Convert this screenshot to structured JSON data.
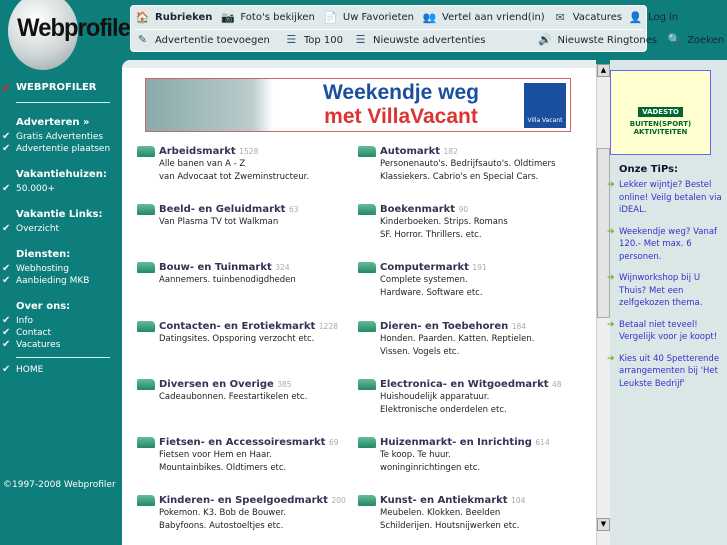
{
  "logo": "Webprofiler",
  "nav": {
    "row1": [
      {
        "icon": "house-icon",
        "label": "Rubrieken"
      },
      {
        "icon": "camera-icon",
        "label": "Foto's bekijken"
      },
      {
        "icon": "favorites-icon",
        "label": "Uw Favorieten"
      },
      {
        "icon": "friends-icon",
        "label": "Vertel aan vriend(in)"
      },
      {
        "icon": "mail-icon",
        "label": "Vacatures"
      },
      {
        "icon": "user-icon",
        "label": "Log in"
      }
    ],
    "row2": [
      {
        "icon": "pen-icon",
        "label": "Advertentie toevoegen"
      },
      {
        "icon": "list-icon",
        "label": "Top 100"
      },
      {
        "icon": "list-icon",
        "label": "Nieuwste advertenties"
      },
      {
        "icon": "speaker-icon",
        "label": "Nieuwste Ringtones"
      },
      {
        "icon": "magnifier-icon",
        "label": "Zoeken"
      }
    ]
  },
  "sidebar": {
    "top": "WEBPROFILER",
    "sections": [
      {
        "title": "Adverteren »",
        "items": [
          "Gratis Advertenties",
          "Advertentie plaatsen"
        ]
      },
      {
        "title": "Vakantiehuizen:",
        "items": [
          "50.000+"
        ]
      },
      {
        "title": "Vakantie Links:",
        "items": [
          "Overzicht"
        ]
      },
      {
        "title": "Diensten:",
        "items": [
          "Webhosting",
          "Aanbieding MKB"
        ]
      },
      {
        "title": "Over ons:",
        "items": [
          "Info",
          "Contact",
          "Vacatures"
        ]
      }
    ],
    "home": "HOME",
    "copyright": "©1997-2008 Webprofiler"
  },
  "banner": {
    "line1": "Weekendje weg",
    "line2": "met VillaVacant",
    "brand": "Villa Vacant"
  },
  "categories": [
    {
      "name": "Arbeidsmarkt",
      "count": "1528",
      "desc": [
        "Alle banen van A - Z",
        "van Advocaat tot Zweminstructeur."
      ]
    },
    {
      "name": "Automarkt",
      "count": "182",
      "desc": [
        "Personenauto's. Bedrijfsauto's. Oldtimers",
        "Klassiekers. Cabrio's en Special Cars."
      ]
    },
    {
      "name": "Beeld- en Geluidmarkt",
      "count": "63",
      "desc": [
        "Van Plasma TV tot Walkman",
        ""
      ]
    },
    {
      "name": "Boekenmarkt",
      "count": "90",
      "desc": [
        "Kinderboeken. Strips. Romans",
        "SF. Horror. Thrillers. etc."
      ]
    },
    {
      "name": "Bouw- en Tuinmarkt",
      "count": "324",
      "desc": [
        "Aannemers. tuinbenodigdheden",
        ""
      ]
    },
    {
      "name": "Computermarkt",
      "count": "191",
      "desc": [
        "Complete systemen.",
        "Hardware. Software etc."
      ]
    },
    {
      "name": "Contacten- en Erotiekmarkt",
      "count": "1228",
      "desc": [
        "Datingsites. Opsporing verzocht etc.",
        ""
      ]
    },
    {
      "name": "Dieren- en Toebehoren",
      "count": "184",
      "desc": [
        "Honden. Paarden. Katten. Reptielen.",
        "Vissen. Vogels etc."
      ]
    },
    {
      "name": "Diversen en Overige",
      "count": "385",
      "desc": [
        "Cadeaubonnen. Feestartikelen etc.",
        ""
      ]
    },
    {
      "name": "Electronica- en Witgoedmarkt",
      "count": "48",
      "desc": [
        "Huishoudelijk apparatuur.",
        "Elektronische onderdelen etc."
      ]
    },
    {
      "name": "Fietsen- en Accessoiresmarkt",
      "count": "69",
      "desc": [
        "Fietsen voor Hem en Haar.",
        "Mountainbikes. Oldtimers etc."
      ]
    },
    {
      "name": "Huizenmarkt- en Inrichting",
      "count": "614",
      "desc": [
        "Te koop. Te huur.",
        "woninginrichtingen etc."
      ]
    },
    {
      "name": "Kinderen- en Speelgoedmarkt",
      "count": "200",
      "desc": [
        "Pokemon. K3. Bob de Bouwer.",
        "Babyfoons. Autostoeltjes etc."
      ]
    },
    {
      "name": "Kunst- en Antiekmarkt",
      "count": "104",
      "desc": [
        "Meubelen. Klokken. Beelden",
        "Schilderijen. Houtsnijwerken etc."
      ]
    }
  ],
  "right": {
    "ad": {
      "brand": "VADESTO",
      "tagline": "BUITEN(SPORT) AKTIVITEITEN"
    },
    "tips_title": "Onze TiPs:",
    "tips": [
      "Lekker wijntje? Bestel online! Veilg betalen via iDEAL.",
      "Weekendje weg? Vanaf 120.- Met max. 6 personen.",
      "Wijnworkshop bij U Thuis? Met een zelfgekozen thema.",
      "Betaal niet teveel! Vergelijk voor je koopt!",
      "Kies uit 40 Spetterende arrangementen bij 'Het Leukste Bedrijf'"
    ]
  },
  "colors": {
    "background": "#0e7e7c",
    "link": "#335",
    "tip": "#33c"
  }
}
